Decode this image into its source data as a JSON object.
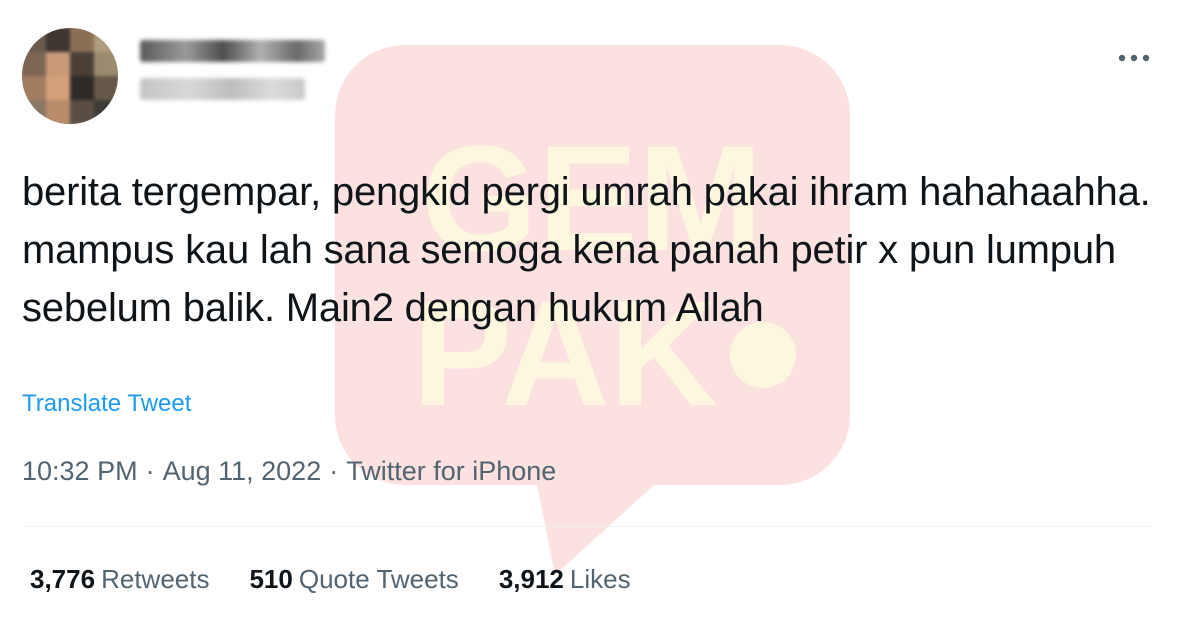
{
  "tweet": {
    "text": "berita tergempar, pengkid pergi umrah pakai ihram hahahaahha. mampus kau lah sana semoga kena panah petir x pun lumpuh sebelum balik. Main2 dengan hukum Allah",
    "translate_label": "Translate Tweet",
    "time": "10:32 PM",
    "date": "Aug 11, 2022",
    "separator": "·",
    "source": "Twitter for iPhone"
  },
  "stats": {
    "retweets_count": "3,776",
    "retweets_label": "Retweets",
    "quotes_count": "510",
    "quotes_label": "Quote Tweets",
    "likes_count": "3,912",
    "likes_label": "Likes"
  },
  "watermark": {
    "line1": "GEM",
    "line2": "PAK",
    "color": "#e8211d",
    "text_color": "#f5c518"
  },
  "icons": {
    "more": "more-horizontal-icon"
  },
  "colors": {
    "text": "#0f1419",
    "muted": "#536471",
    "link": "#1d9bf0"
  }
}
